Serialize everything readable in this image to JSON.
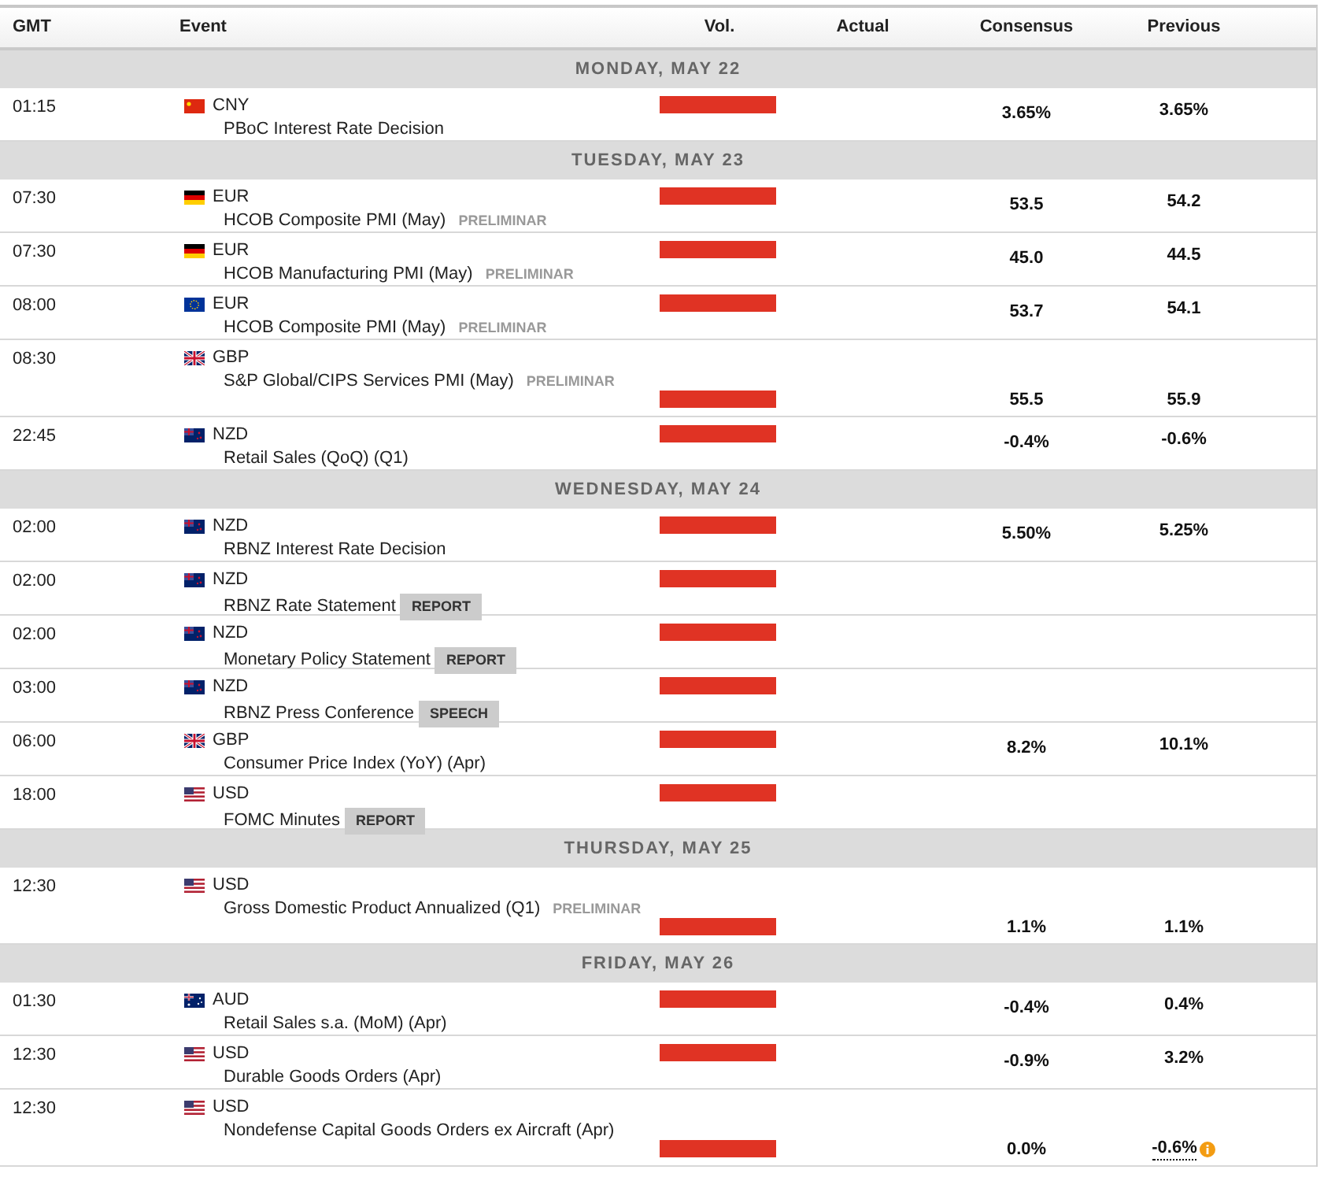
{
  "columns": [
    "GMT",
    "Event",
    "Vol.",
    "Actual",
    "Consensus",
    "Previous"
  ],
  "days": [
    {
      "label": "MONDAY, MAY 22",
      "events": [
        {
          "time": "01:15",
          "kind": "china",
          "currency": "CNY",
          "name": "PBoC Interest Rate Decision",
          "level": 1,
          "tall": false,
          "consensus": "3.65%",
          "previous": "3.65%",
          "revised": false
        }
      ]
    },
    {
      "label": "TUESDAY, MAY 23",
      "events": [
        {
          "time": "07:30",
          "kind": "germany",
          "currency": "EUR",
          "name": "HCOB Composite PMI (May)",
          "tag": {
            "text": "PRELIMINAR",
            "kind": "label"
          },
          "level": 1,
          "tall": false,
          "consensus": "53.5",
          "previous": "54.2",
          "revised": false
        },
        {
          "time": "07:30",
          "kind": "germany",
          "currency": "EUR",
          "name": "HCOB Manufacturing PMI (May)",
          "tag": {
            "text": "PRELIMINAR",
            "kind": "label"
          },
          "level": 1,
          "tall": false,
          "consensus": "45.0",
          "previous": "44.5",
          "revised": false
        },
        {
          "time": "08:00",
          "kind": "europe",
          "currency": "EUR",
          "name": "HCOB Composite PMI (May)",
          "tag": {
            "text": "PRELIMINAR",
            "kind": "label"
          },
          "level": 1,
          "tall": false,
          "consensus": "53.7",
          "previous": "54.1",
          "revised": false
        },
        {
          "time": "08:30",
          "kind": "britain",
          "currency": "GBP",
          "name": "S&P Global/CIPS Services PMI (May)",
          "tag": {
            "text": "PRELIMINAR",
            "kind": "label"
          },
          "level": 1,
          "tall": true,
          "consensus": "55.5",
          "previous": "55.9",
          "revised": false
        },
        {
          "time": "22:45",
          "kind": "zealand",
          "currency": "NZD",
          "name": "Retail Sales (QoQ) (Q1)",
          "level": 1,
          "tall": false,
          "consensus": "-0.4%",
          "previous": "-0.6%",
          "revised": false
        }
      ]
    },
    {
      "label": "WEDNESDAY, MAY 24",
      "events": [
        {
          "time": "02:00",
          "kind": "zealand",
          "currency": "NZD",
          "name": "RBNZ Interest Rate Decision",
          "level": 1,
          "tall": false,
          "consensus": "5.50%",
          "previous": "5.25%",
          "revised": false
        },
        {
          "time": "02:00",
          "kind": "zealand",
          "currency": "NZD",
          "name": "RBNZ Rate Statement",
          "tag": {
            "text": "REPORT",
            "kind": "badge"
          },
          "level": 1,
          "tall": false,
          "revised": false
        },
        {
          "time": "02:00",
          "kind": "zealand",
          "currency": "NZD",
          "name": "Monetary Policy Statement",
          "tag": {
            "text": "REPORT",
            "kind": "badge"
          },
          "level": 1,
          "tall": false,
          "revised": false
        },
        {
          "time": "03:00",
          "kind": "zealand",
          "currency": "NZD",
          "name": "RBNZ Press Conference",
          "tag": {
            "text": "SPEECH",
            "kind": "badge"
          },
          "level": 1,
          "tall": false,
          "revised": false
        },
        {
          "time": "06:00",
          "kind": "britain",
          "currency": "GBP",
          "name": "Consumer Price Index (YoY) (Apr)",
          "level": 1,
          "tall": false,
          "consensus": "8.2%",
          "previous": "10.1%",
          "revised": false
        },
        {
          "time": "18:00",
          "kind": "usa",
          "currency": "USD",
          "name": "FOMC Minutes",
          "tag": {
            "text": "REPORT",
            "kind": "badge"
          },
          "level": 1,
          "tall": false,
          "revised": false
        }
      ]
    },
    {
      "label": "THURSDAY, MAY 25",
      "events": [
        {
          "time": "12:30",
          "kind": "usa",
          "currency": "USD",
          "name": "Gross Domestic Product Annualized (Q1)",
          "tag": {
            "text": "PRELIMINAR",
            "kind": "label"
          },
          "level": 1,
          "tall": true,
          "consensus": "1.1%",
          "previous": "1.1%",
          "revised": false
        }
      ]
    },
    {
      "label": "FRIDAY, MAY 26",
      "events": [
        {
          "time": "01:30",
          "kind": "australia",
          "currency": "AUD",
          "name": "Retail Sales s.a. (MoM) (Apr)",
          "level": 1,
          "tall": false,
          "consensus": "-0.4%",
          "previous": "0.4%",
          "revised": false
        },
        {
          "time": "12:30",
          "kind": "usa",
          "currency": "USD",
          "name": "Durable Goods Orders (Apr)",
          "level": 1,
          "tall": false,
          "consensus": "-0.9%",
          "previous": "3.2%",
          "revised": false
        },
        {
          "time": "12:30",
          "kind": "usa",
          "currency": "USD",
          "name": "Nondefense Capital Goods Orders ex Aircraft (Apr)",
          "level": 1,
          "tall": true,
          "consensus": "0.0%",
          "previous": "-0.6%",
          "revised": true
        }
      ]
    }
  ]
}
